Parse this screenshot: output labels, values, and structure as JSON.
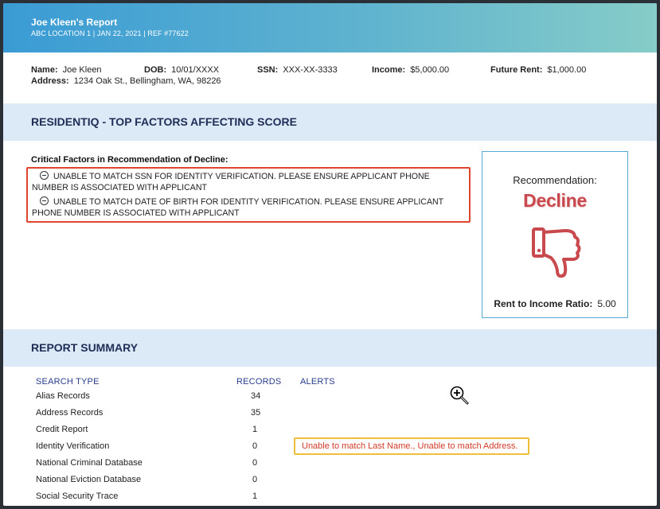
{
  "banner": {
    "title": "Joe Kleen's Report",
    "subtitle": "ABC LOCATION 1 | JAN 22, 2021 | REF #77622"
  },
  "applicant": {
    "name_label": "Name:",
    "name": "Joe Kleen",
    "dob_label": "DOB:",
    "dob": "10/01/XXXX",
    "ssn_label": "SSN:",
    "ssn": "XXX-XX-3333",
    "income_label": "Income:",
    "income": "$5,000.00",
    "future_rent_label": "Future Rent:",
    "future_rent": "$1,000.00",
    "address_label": "Address:",
    "address": "1234 Oak St., Bellingham, WA, 98226"
  },
  "factors": {
    "heading": "RESIDENTIQ - TOP FACTORS AFFECTING SCORE",
    "critical_title": "Critical Factors in Recommendation of Decline:",
    "items": [
      "UNABLE TO MATCH SSN FOR IDENTITY VERIFICATION. PLEASE ENSURE APPLICANT PHONE NUMBER IS ASSOCIATED WITH APPLICANT",
      "UNABLE TO MATCH DATE OF BIRTH FOR IDENTITY VERIFICATION. PLEASE ENSURE APPLICANT PHONE NUMBER IS ASSOCIATED WITH APPLICANT"
    ]
  },
  "recommendation": {
    "label": "Recommendation:",
    "value": "Decline",
    "icon": "thumbs-down-icon",
    "ratio_label": "Rent to Income Ratio:",
    "ratio_value": "5.00",
    "accent_color": "#c94a4e"
  },
  "summary": {
    "heading": "REPORT SUMMARY",
    "col_type": "SEARCH TYPE",
    "col_records": "RECORDS",
    "col_alerts": "ALERTS",
    "rows": [
      {
        "type": "Alias Records",
        "records": "34",
        "alert": ""
      },
      {
        "type": "Address Records",
        "records": "35",
        "alert": ""
      },
      {
        "type": "Credit Report",
        "records": "1",
        "alert": ""
      },
      {
        "type": "Identity Verification",
        "records": "0",
        "alert": "Unable to match Last Name., Unable to match Address."
      },
      {
        "type": "National Criminal Database",
        "records": "0",
        "alert": ""
      },
      {
        "type": "National Eviction Database",
        "records": "0",
        "alert": ""
      },
      {
        "type": "Social Security Trace",
        "records": "1",
        "alert": ""
      }
    ]
  },
  "cursor": {
    "icon": "zoom-in-cursor-icon"
  }
}
